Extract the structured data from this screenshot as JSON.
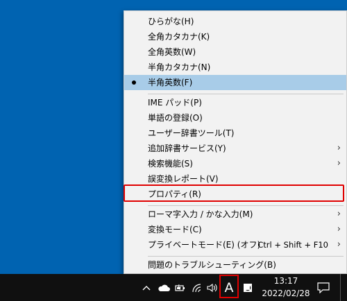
{
  "menu": {
    "items": [
      {
        "label": "ひらがな(H)"
      },
      {
        "label": "全角カタカナ(K)"
      },
      {
        "label": "全角英数(W)"
      },
      {
        "label": "半角カタカナ(N)"
      },
      {
        "label": "半角英数(F)",
        "checked": true
      },
      {
        "label": "IME パッド(P)"
      },
      {
        "label": "単語の登録(O)"
      },
      {
        "label": "ユーザー辞書ツール(T)"
      },
      {
        "label": "追加辞書サービス(Y)",
        "submenu": true
      },
      {
        "label": "検索機能(S)",
        "submenu": true
      },
      {
        "label": "誤変換レポート(V)"
      },
      {
        "label": "プロパティ(R)",
        "highlighted": true
      },
      {
        "label": "ローマ字入力 / かな入力(M)",
        "submenu": true
      },
      {
        "label": "変換モード(C)",
        "submenu": true
      },
      {
        "label": "プライベートモード(E) (オフ)",
        "shortcut": "Ctrl + Shift + F10",
        "submenu": true
      },
      {
        "label": "問題のトラブルシューティング(B)"
      }
    ],
    "chevron": "›"
  },
  "taskbar": {
    "ime_indicator": "A",
    "time": "13:17",
    "date": "2022/02/28",
    "icons": [
      "chevron-up-icon",
      "onedrive-cloud-icon",
      "battery-icon",
      "wifi-icon",
      "volume-icon",
      "ime-mode-icon",
      "ime-pad-icon",
      "notification-icon"
    ]
  },
  "colors": {
    "desktop": "#0063b1",
    "menu_bg": "#f2f2f2",
    "checked_bg": "#a8cce8",
    "highlight": "#e00000",
    "taskbar": "#101010"
  }
}
